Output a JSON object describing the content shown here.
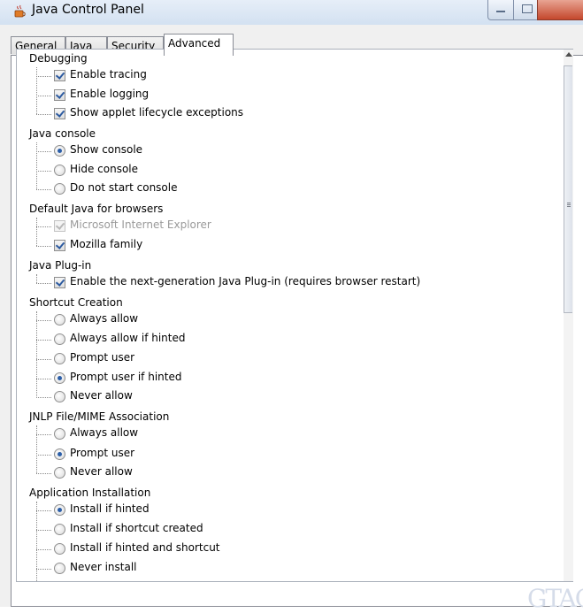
{
  "window": {
    "title": "Java Control Panel",
    "icon": "java-coffee-cup-icon"
  },
  "tabs": [
    {
      "label": "General",
      "active": false
    },
    {
      "label": "Java",
      "active": false
    },
    {
      "label": "Security",
      "active": false
    },
    {
      "label": "Advanced",
      "active": true
    }
  ],
  "settings": {
    "debugging": {
      "label": "Debugging",
      "items": [
        {
          "label": "Enable tracing",
          "checked": true
        },
        {
          "label": "Enable logging",
          "checked": true
        },
        {
          "label": "Show applet lifecycle exceptions",
          "checked": true
        }
      ]
    },
    "java_console": {
      "label": "Java console",
      "items": [
        {
          "label": "Show console",
          "selected": true
        },
        {
          "label": "Hide console",
          "selected": false
        },
        {
          "label": "Do not start console",
          "selected": false
        }
      ]
    },
    "default_java": {
      "label": "Default Java for browsers",
      "items": [
        {
          "label": "Microsoft Internet Explorer",
          "checked": true,
          "disabled": true
        },
        {
          "label": "Mozilla family",
          "checked": true
        }
      ]
    },
    "plugin": {
      "label": "Java Plug-in",
      "items": [
        {
          "label": "Enable the next-generation Java Plug-in (requires browser restart)",
          "checked": true
        }
      ]
    },
    "shortcut": {
      "label": "Shortcut Creation",
      "items": [
        {
          "label": "Always allow",
          "selected": false
        },
        {
          "label": "Always allow if hinted",
          "selected": false
        },
        {
          "label": "Prompt user",
          "selected": false
        },
        {
          "label": "Prompt user if hinted",
          "selected": true
        },
        {
          "label": "Never allow",
          "selected": false
        }
      ]
    },
    "jnlp": {
      "label": "JNLP File/MIME Association",
      "items": [
        {
          "label": "Always allow",
          "selected": false
        },
        {
          "label": "Prompt user",
          "selected": true
        },
        {
          "label": "Never allow",
          "selected": false
        }
      ]
    },
    "app_install": {
      "label": "Application Installation",
      "items": [
        {
          "label": "Install if hinted",
          "selected": true
        },
        {
          "label": "Install if shortcut created",
          "selected": false
        },
        {
          "label": "Install if hinted and shortcut",
          "selected": false
        },
        {
          "label": "Never install",
          "selected": false
        }
      ]
    }
  },
  "watermark": "GTAC"
}
